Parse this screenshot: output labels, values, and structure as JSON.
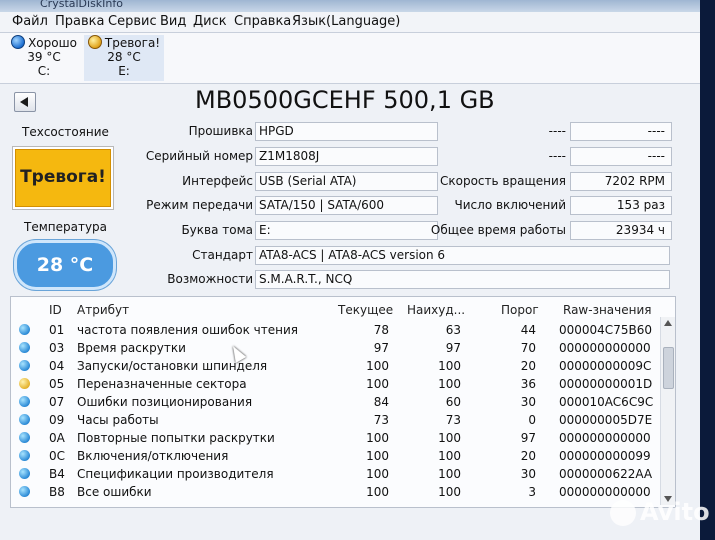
{
  "title_bar": "CrystalDiskInfo",
  "menu": [
    "Файл",
    "Правка",
    "Сервис",
    "Вид",
    "Диск",
    "Справка",
    "Язык(Language)"
  ],
  "drives": [
    {
      "status": "Хорошо",
      "temp": "39 °C",
      "letter": "C:",
      "color": "blue"
    },
    {
      "status": "Тревога!",
      "temp": "28 °C",
      "letter": "E:",
      "color": "yellow"
    }
  ],
  "disk_title": "MB0500GCEHF 500,1 GB",
  "health": {
    "label": "Техсостояние",
    "value": "Тревога!"
  },
  "temperature": {
    "label": "Температура",
    "value": "28 °C"
  },
  "info": {
    "firmware_label": "Прошивка",
    "firmware": "HPGD",
    "serial_label": "Серийный номер",
    "serial": "Z1M1808J",
    "interface_label": "Интерфейс",
    "interface": "USB (Serial ATA)",
    "transfer_label": "Режим передачи",
    "transfer": "SATA/150 | SATA/600",
    "letter_label": "Буква тома",
    "letter": "E:",
    "standard_label": "Стандарт",
    "standard": "ATA8-ACS | ATA8-ACS version 6",
    "features_label": "Возможности",
    "features": "S.M.A.R.T., NCQ",
    "right_top1_label": "----",
    "right_top1": "----",
    "right_top2_label": "----",
    "right_top2": "----",
    "rotation_label": "Скорость вращения",
    "rotation": "7202 RPM",
    "power_count_label": "Число включений",
    "power_count": "153 раз",
    "power_hours_label": "Общее время работы",
    "power_hours": "23934 ч"
  },
  "smart": {
    "headers": [
      "ID",
      "Атрибут",
      "Текущее",
      "Наихуд...",
      "Порог",
      "Raw-значения"
    ],
    "rows": [
      {
        "id": "01",
        "name": "частота появления ошибок чтения",
        "cur": "78",
        "worst": "63",
        "thr": "44",
        "raw": "000004C75B60",
        "status": "blue"
      },
      {
        "id": "03",
        "name": "Время раскрутки",
        "cur": "97",
        "worst": "97",
        "thr": "70",
        "raw": "000000000000",
        "status": "blue"
      },
      {
        "id": "04",
        "name": "Запуски/остановки шпинделя",
        "cur": "100",
        "worst": "100",
        "thr": "20",
        "raw": "00000000009C",
        "status": "blue"
      },
      {
        "id": "05",
        "name": "Переназначенные сектора",
        "cur": "100",
        "worst": "100",
        "thr": "36",
        "raw": "00000000001D",
        "status": "yellow"
      },
      {
        "id": "07",
        "name": "Ошибки позиционирования",
        "cur": "84",
        "worst": "60",
        "thr": "30",
        "raw": "000010AC6C9C",
        "status": "blue"
      },
      {
        "id": "09",
        "name": "Часы работы",
        "cur": "73",
        "worst": "73",
        "thr": "0",
        "raw": "000000005D7E",
        "status": "blue"
      },
      {
        "id": "0A",
        "name": "Повторные попытки раскрутки",
        "cur": "100",
        "worst": "100",
        "thr": "97",
        "raw": "000000000000",
        "status": "blue"
      },
      {
        "id": "0C",
        "name": "Включения/отключения",
        "cur": "100",
        "worst": "100",
        "thr": "20",
        "raw": "000000000099",
        "status": "blue"
      },
      {
        "id": "B4",
        "name": "Спецификации производителя",
        "cur": "100",
        "worst": "100",
        "thr": "30",
        "raw": "0000000622AA",
        "status": "blue"
      },
      {
        "id": "B8",
        "name": "Все ошибки",
        "cur": "100",
        "worst": "100",
        "thr": "3",
        "raw": "000000000000",
        "status": "blue"
      }
    ]
  },
  "watermark": "Avito"
}
